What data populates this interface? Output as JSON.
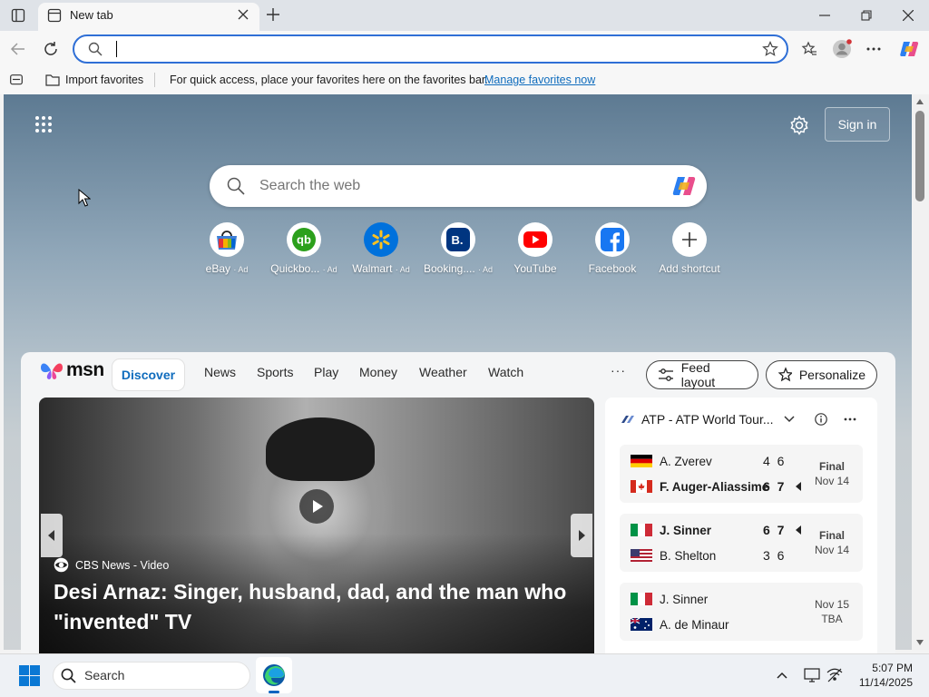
{
  "browser": {
    "tab_title": "New tab",
    "address_value": "",
    "favorites_bar": {
      "import_label": "Import favorites",
      "message": "For quick access, place your favorites here on the favorites bar.",
      "manage_link": "Manage favorites now"
    }
  },
  "newtab": {
    "sign_in": "Sign in",
    "search_placeholder": "Search the web",
    "shortcuts": [
      {
        "label": "eBay",
        "ad": "· Ad",
        "icon": "ebay-icon"
      },
      {
        "label": "Quickbo...",
        "ad": "· Ad",
        "icon": "quickbooks-icon"
      },
      {
        "label": "Walmart",
        "ad": "· Ad",
        "icon": "walmart-icon"
      },
      {
        "label": "Booking....",
        "ad": "· Ad",
        "icon": "booking-icon"
      },
      {
        "label": "YouTube",
        "ad": "",
        "icon": "youtube-icon"
      },
      {
        "label": "Facebook",
        "ad": "",
        "icon": "facebook-icon"
      },
      {
        "label": "Add shortcut",
        "ad": "",
        "icon": "plus-icon"
      }
    ]
  },
  "msn": {
    "logo": "msn",
    "tabs": [
      "Discover",
      "News",
      "Sports",
      "Play",
      "Money",
      "Weather",
      "Watch"
    ],
    "more": "···",
    "feed_layout": "Feed layout",
    "personalize": "Personalize",
    "hero": {
      "source": "CBS News - Video",
      "headline_line1": "Desi Arnaz: Singer, husband, dad, and the man who",
      "headline_line2": "\"invented\" TV"
    },
    "sports_card": {
      "title": "ATP - ATP World Tour...",
      "matches": [
        {
          "p1": "A. Zverev",
          "p1_flag": "germany",
          "p1_score": "4 6",
          "p2": "F. Auger-Aliassime",
          "p2_flag": "canada",
          "p2_score": "6 7",
          "status1": "Final",
          "status2": "Nov 14",
          "winner": 2
        },
        {
          "p1": "J. Sinner",
          "p1_flag": "italy",
          "p1_score": "6 7",
          "p2": "B. Shelton",
          "p2_flag": "usa",
          "p2_score": "3 6",
          "status1": "Final",
          "status2": "Nov 14",
          "winner": 1
        },
        {
          "p1": "J. Sinner",
          "p1_flag": "italy",
          "p1_score": "",
          "p2": "A. de Minaur",
          "p2_flag": "australia",
          "p2_score": "",
          "status1": "Nov 15",
          "status2": "TBA",
          "winner": 0
        }
      ]
    }
  },
  "taskbar": {
    "search_label": "Search",
    "time": "5:07 PM",
    "date": "11/14/2025"
  },
  "colors": {
    "accent": "#0f6cbd",
    "address_border": "#2f6fd6"
  }
}
